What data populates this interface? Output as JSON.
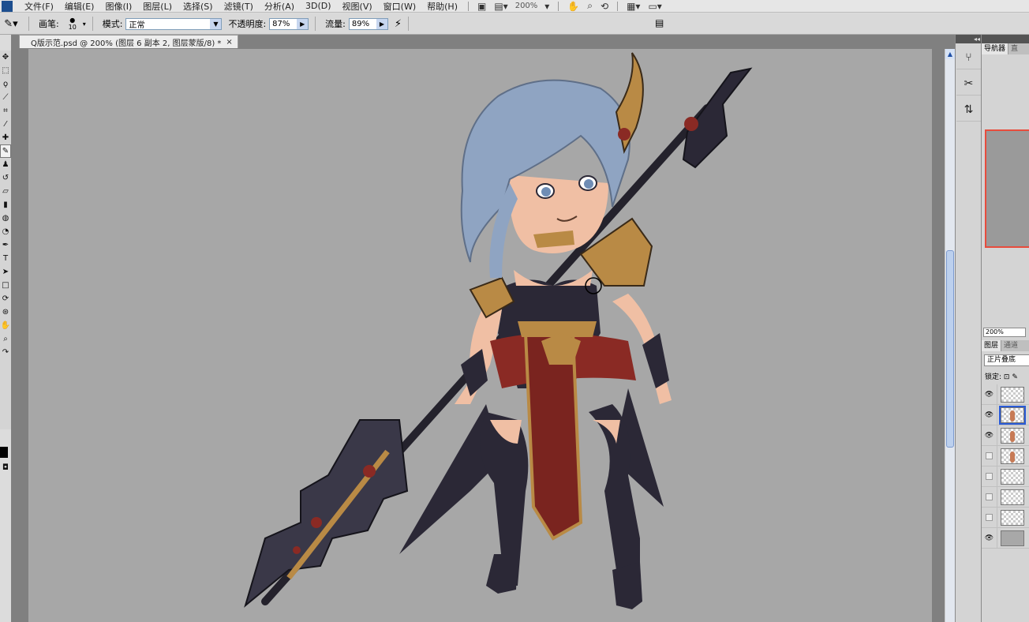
{
  "menubar": {
    "items": [
      "文件(F)",
      "编辑(E)",
      "图像(I)",
      "图层(L)",
      "选择(S)",
      "滤镜(T)",
      "分析(A)",
      "3D(D)",
      "视图(V)",
      "窗口(W)",
      "帮助(H)"
    ],
    "zoom": "200%"
  },
  "options": {
    "brush_label": "画笔:",
    "brush_size": "10",
    "mode_label": "模式:",
    "mode_value": "正常",
    "opacity_label": "不透明度:",
    "opacity_value": "87%",
    "flow_label": "流量:",
    "flow_value": "89%"
  },
  "document": {
    "tab_title": "Q版示范.psd @ 200% (图层 6 副本 2, 图层蒙版/8) *",
    "close": "×"
  },
  "panels": {
    "top_tabs": [
      "导航器",
      "直"
    ],
    "nav_zoom": "200%",
    "layers_tabs": [
      "图层",
      "通道"
    ],
    "blend_mode": "正片叠底",
    "lock_label": "锁定:",
    "layers": [
      {
        "visible": true,
        "thumb": "transparent",
        "selected": false
      },
      {
        "visible": true,
        "thumb": "figure",
        "selected": true
      },
      {
        "visible": true,
        "thumb": "figure",
        "selected": false
      },
      {
        "visible": false,
        "thumb": "figure",
        "selected": false
      },
      {
        "visible": false,
        "thumb": "transparent",
        "selected": false
      },
      {
        "visible": false,
        "thumb": "transparent",
        "selected": false
      },
      {
        "visible": false,
        "thumb": "transparent",
        "selected": false
      },
      {
        "visible": true,
        "thumb": "gray",
        "selected": false
      }
    ]
  },
  "colors": {
    "canvas": "#a7a7a7",
    "hair": "#8fa4c2",
    "skin": "#f0bfa4",
    "armor_dark": "#2b2836",
    "gold": "#b98a45",
    "cloth_red": "#8a2a24"
  }
}
